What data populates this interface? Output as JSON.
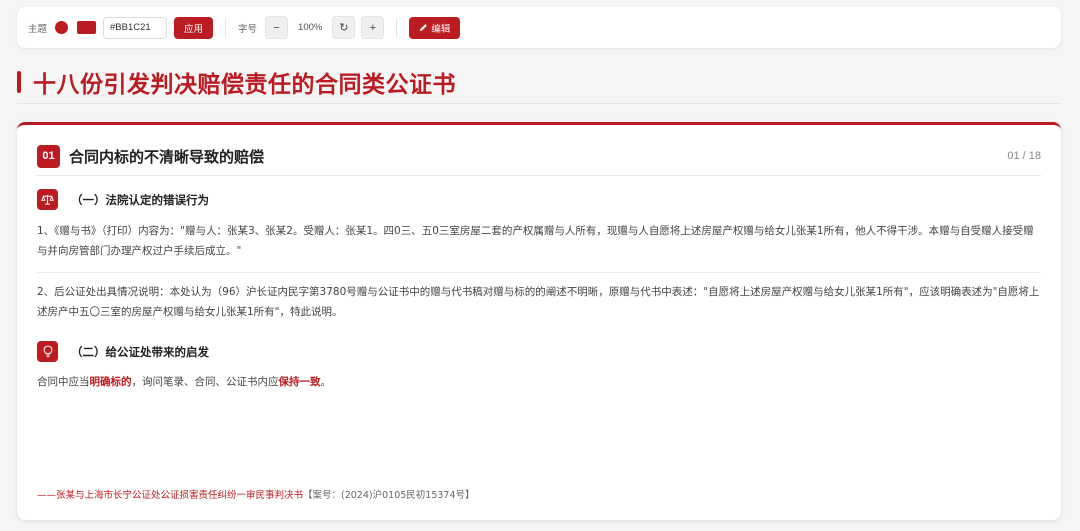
{
  "toolbar": {
    "theme_label": "主题",
    "hex_value": "#BB1C21",
    "apply_label": "应用",
    "font_label": "字号",
    "minus_glyph": "−",
    "zoom": "100%",
    "reset_glyph": "↻",
    "plus_glyph": "+",
    "edit_label": "编辑",
    "edit_icon": "pencil-icon"
  },
  "page_title": "十八份引发判决赔偿责任的合同类公证书",
  "card": {
    "number": "01",
    "title": "合同内标的不清晰导致的赔偿",
    "pager": "01 / 18",
    "section1": {
      "icon": "scales-icon",
      "title": "（一）法院认定的错误行为"
    },
    "para1": "1、《赠与书》（打印）内容为：\"赠与人：张某3、张某2。受赠人：张某1。四0三、五0三室房屋二套的产权属赠与人所有，现赠与人自愿将上述房屋产权赠与给女儿张某1所有，他人不得干涉。本赠与自受赠人接受赠与并向房管部门办理产权过户手续后成立。\"",
    "para2": "2、后公证处出具情况说明：本处认为（96）沪长证内民字第3780号赠与公证书中的赠与代书稿对赠与标的的阐述不明晰，原赠与代书中表述：\"自愿将上述房屋产权赠与给女儿张某1所有\"，应该明确表述为\"自愿将上述房产中五〇三室的房屋产权赠与给女儿张某1所有\"，特此说明。",
    "section2": {
      "icon": "lightbulb-icon",
      "title": "（二）给公证处带来的启发"
    },
    "insight": {
      "part1": "合同中应当",
      "highlight1": "明确标的",
      "part2": "，询问笔录、合同、公证书内应",
      "highlight2": "保持一致",
      "part3": "。"
    },
    "source_title": "——张某与上海市长宁公证处公证损害责任纠纷一审民事判决书",
    "source_case": "【案号：(2024)沪0105民初15374号】"
  },
  "colors": {
    "accent": "#BB1C21"
  }
}
